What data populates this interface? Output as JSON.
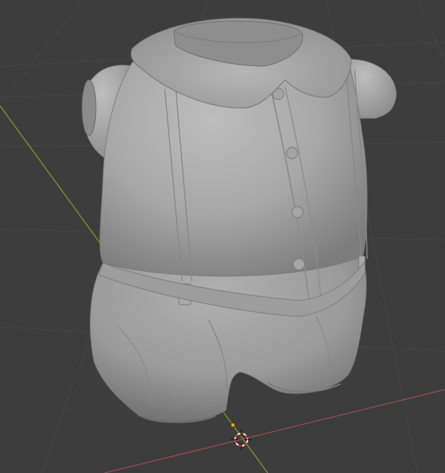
{
  "viewport": {
    "background": "#3d3d3d",
    "grid_visible": true,
    "grid_color": "#474747",
    "x_axis_color": "#9a4b50",
    "y_axis_color": "#7d9632"
  },
  "model": {
    "object": "shirt-and-shorts-sculpt",
    "shade": "matcap-clay-gray",
    "shirt_button_count": 4,
    "suspender_count": 2
  },
  "cursor_3d": {
    "icon": "3d-cursor-icon",
    "ring_colors": [
      "#ffffff",
      "#d63a3a"
    ]
  }
}
